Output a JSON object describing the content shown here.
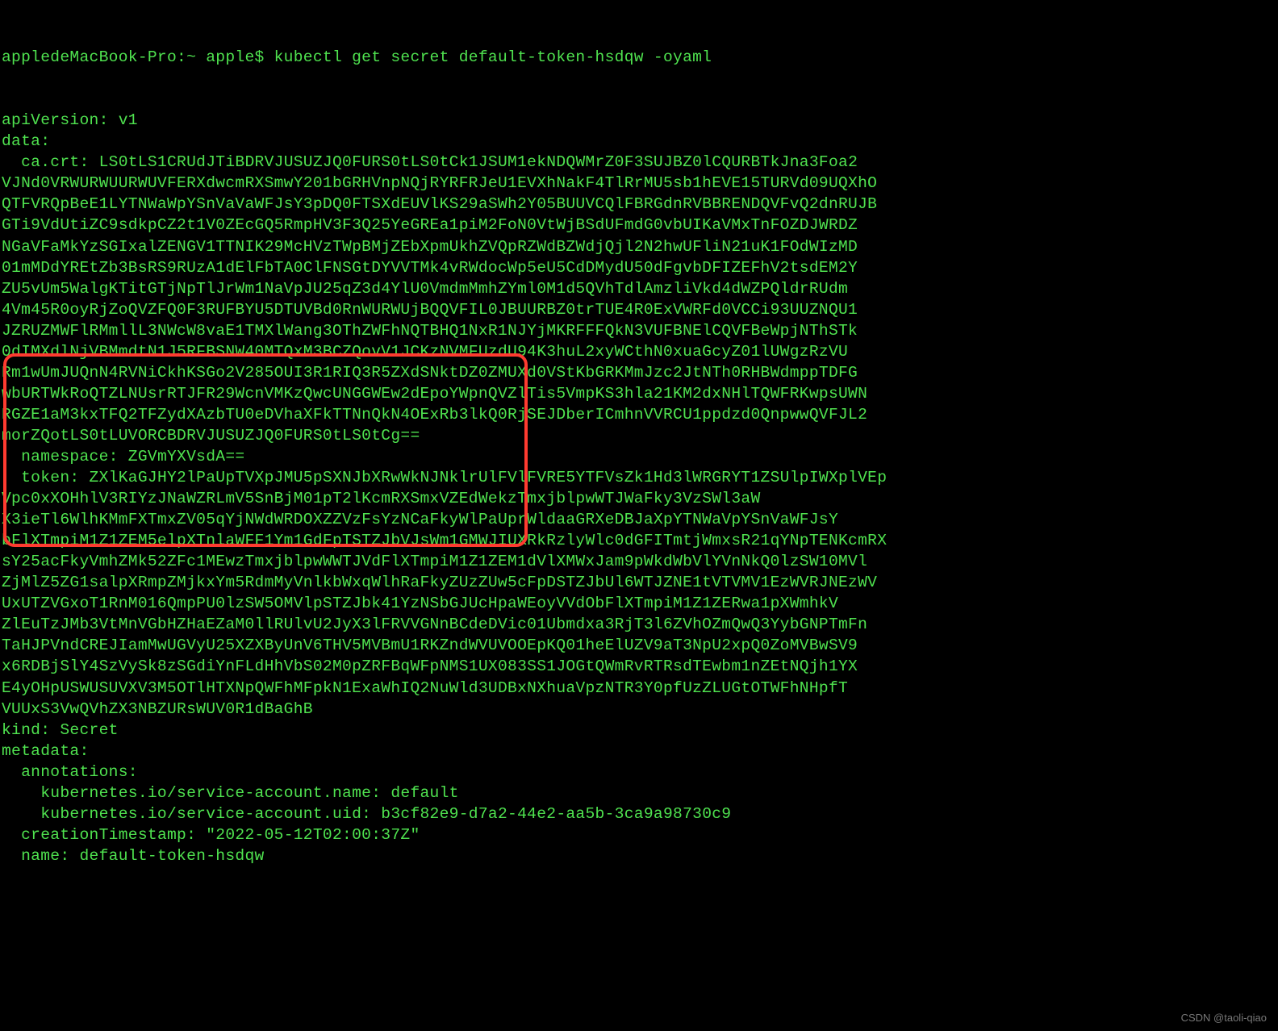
{
  "prompt": "appledeMacBook-Pro:~ apple$ kubectl get secret default-token-hsdqw -oyaml",
  "lines": [
    "apiVersion: v1",
    "data:",
    "  ca.crt: LS0tLS1CRUdJTiBDRVJUSUZJQ0FURS0tLS0tCk1JSUM1ekNDQWMrZ0F3SUJBZ0lCQURBTkJna3Foa2",
    "VJNd0VRWURWUURWUVFERXdwcmRXSmwY201bGRHVnpNQjRYRFRJeU1EVXhNakF4TlRrMU5sb1hEVE15TURVd09UQXhO",
    "QTFVRQpBeE1LYTNWaWpYSnVaVaWFJsY3pDQ0FTSXdEUVlKS29aSWh2Y05BUUVCQlFBRGdnRVBBRENDQVFvQ2dnRUJB",
    "GTi9VdUtiZC9sdkpCZ2t1V0ZEcGQ5RmpHV3F3Q25YeGREa1piM2FoN0VtWjBSdUFmdG0vbUIKaVMxTnFOZDJWRDZ",
    "NGaVFaMkYzSGIxalZENGV1TTNIK29McHVzTWpBMjZEbXpmUkhZVQpRZWdBZWdjQjl2N2hwUFliN21uK1FOdWIzMD",
    "01mMDdYREtZb3BsRS9RUzA1dElFbTA0ClFNSGtDYVVTMk4vRWdocWp5eU5CdDMydU50dFgvbDFIZEFhV2tsdEM2Y",
    "ZU5vUm5WalgKTitGTjNpTlJrWm1NaVpJU25qZ3d4YlU0VmdmMmhZYml0M1d5QVhTdlAmzliVkd4dWZPQldrRUdm",
    "4Vm45R0oyRjZoQVZFQ0F3RUFBYU5DTUVBd0RnWURWUjBQQVFIL0JBUURBZ0trTUE4R0ExVWRFd0VCCi93UUZNQU1",
    "JZRUZMWFlRMmllL3NWcW8vaE1TMXlWang3OThZWFhNQTBHQ1NxR1NJYjMKRFFFQkN3VUFBNElCQVFBeWpjNThSTk",
    "0dIMXdlNjVBMmdtN1J5RFBSNW40MTQxM3BCZQovV1JCKzNVMFUzdU94K3huL2xyWCthN0xuaGcyZ01lUWgzRzVU",
    "Rm1wUmJUQnN4RVNiCkhKSGo2V285OUI3R1RIQ3R5ZXdSNktDZ0ZMUXd0VStKbGRKMmJzc2JtNTh0RHBWdmppTDFG",
    "wbURTWkRoQTZLNUsrRTJFR29WcnVMKzQwcUNGGWEw2dEpoYWpnQVZlTis5VmpKS3hla21KM2dxNHlTQWFRKwpsUWN",
    "RGZE1aM3kxTFQ2TFZydXAzbTU0eDVhaXFkTTNnQkN4OExRb3lkQ0RjSEJDberICmhnVVRCU1ppdzd0QnpwwQVFJL2",
    "morZQotLS0tLUVORCBDRVJUSUZJQ0FURS0tLS0tCg==",
    "  namespace: ZGVmYXVsdA==",
    "  token: ZXlKaGJHY2lPaUpTVXpJMU5pSXNJbXRwWkNJNklrUlFVlFVRE5YTFVsZk1Hd3lWRGRYT1ZSUlpIWXplVEp",
    "Vpc0xXOHhlV3RIYzJNaWZRLmV5SnBjM01pT2lKcmRXSmxVZEdWekzTmxjblpwWTJWaFky3VzSWl3aW",
    "X3ieTl6WlhKMmFXTmxZV05qYjNWdWRDOXZZVzFsYzNCaFkyWlPaUprWldaaGRXeDBJaXpYTNWaVpYSnVaWFJsY",
    "bFlXTmpiM1Z1ZEM5elpXTnlaWFF1Ym1GdFpTSTZJbVJsWm1GMWJIUXRkRzlyWlc0dGFITmtjWmxsR21qYNpTENKcmRX",
    "sY25acFkyVmhZMk52ZFc1MEwzTmxjblpwWWTJVdFlXTmpiM1Z1ZEM1dVlXMWxJam9pWkdWbVlYVnNkQ0lzSW10MVl",
    "ZjMlZ5ZG1salpXRmpZMjkxYm5RdmMyVnlkbWxqWlhRaFkyZUzZUw5cFpDSTZJbUl6WTJZNE1tVTVMV1EzWVRJNEzWV",
    "UxUTZVGxoT1RnM016QmpPU0lzSW5OMVlpSTZJbk41YzNSbGJUcHpaWEoyVVdObFlXTmpiM1Z1ZERwa1pXWmhkV",
    "ZlEuTzJMb3VtMnVGbHZHaEZaM0llRUlvU2JyX3lFRVVGNnBCdeDVic01Ubmdxa3RjT3l6ZVhOZmQwQ3YybGNPTmFn",
    "TaHJPVndCREJIamMwUGVyU25XZXByUnV6THV5MVBmU1RKZndWVUVOOEpKQ01heElUZV9aT3NpU2xpQ0ZoMVBwSV9",
    "x6RDBjSlY4SzVySk8zSGdiYnFLdHhVbS02M0pZRFBqWFpNMS1UX083SS1JOGtQWmRvRTRsdTEwbm1nZEtNQjh1YX",
    "E4yOHpUSWUSUVXV3M5OTlHTXNpQWFhMFpkN1ExaWhIQ2NuWld3UDBxNXhuaVpzNTR3Y0pfUzZLUGtOTWFhNHpfT",
    "VUUxS3VwQVhZX3NBZURsWUV0R1dBaGhB",
    "kind: Secret",
    "metadata:",
    "  annotations:",
    "    kubernetes.io/service-account.name: default",
    "    kubernetes.io/service-account.uid: b3cf82e9-d7a2-44e2-aa5b-3ca9a98730c9",
    "  creationTimestamp: \"2022-05-12T02:00:37Z\"",
    "  name: default-token-hsdqw"
  ],
  "watermark": "CSDN @taoli-qiao"
}
